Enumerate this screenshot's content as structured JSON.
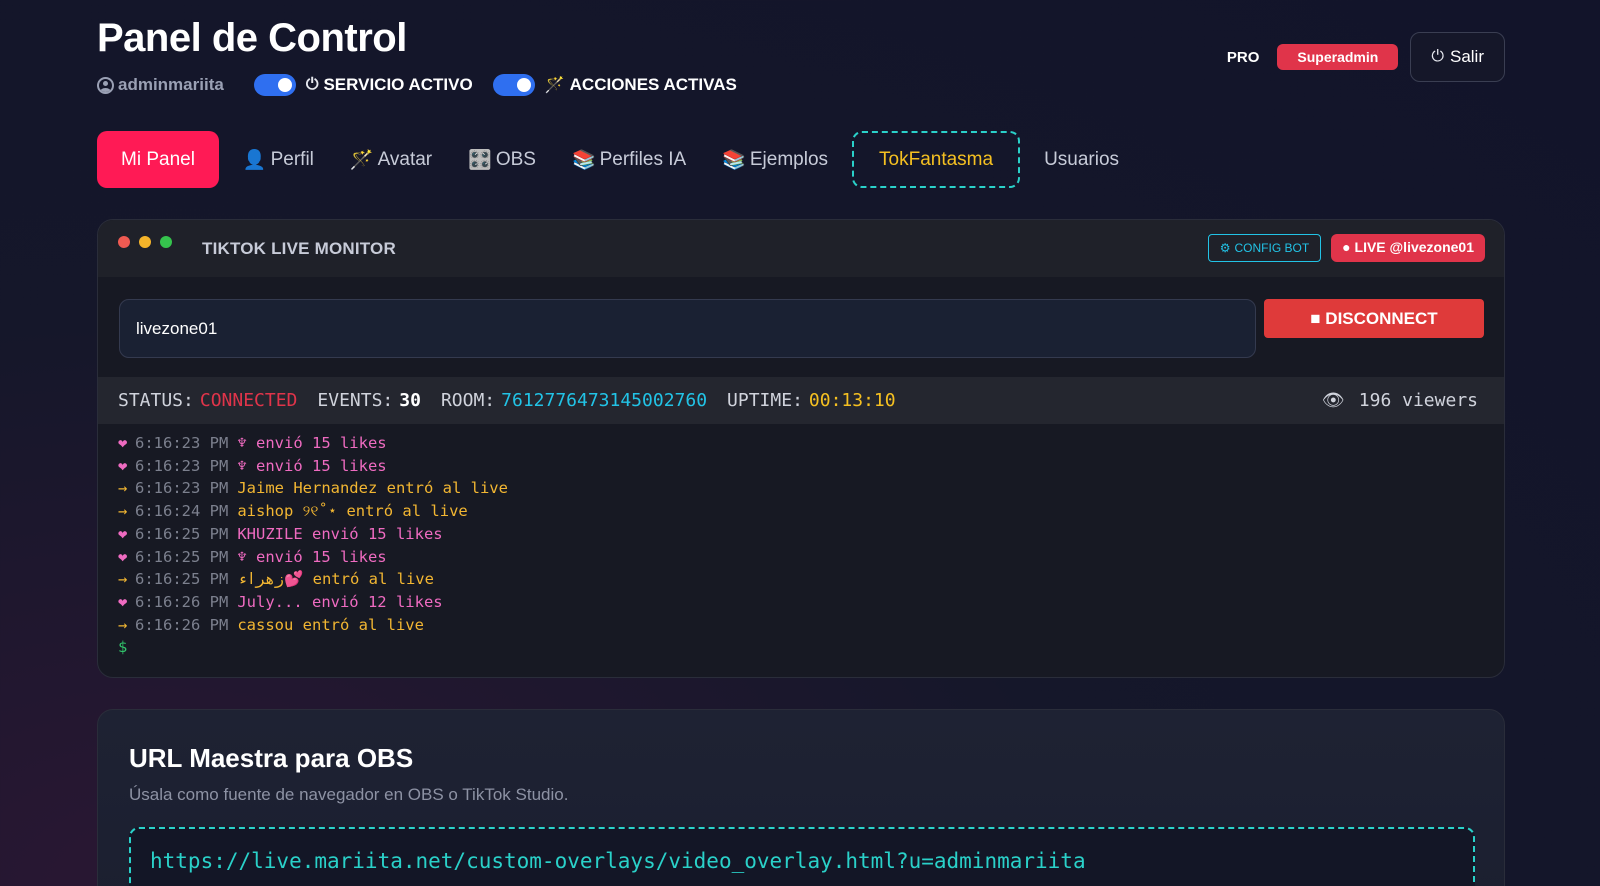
{
  "header": {
    "title": "Panel de Control",
    "username": "adminmariita",
    "service_label": "SERVICIO ACTIVO",
    "actions_label": "ACCIONES ACTIVAS",
    "service_enabled": true,
    "actions_enabled": true,
    "plan": "PRO",
    "role": "Superadmin",
    "logout_label": "Salir"
  },
  "tabs": [
    {
      "label": "Mi Panel",
      "icon": "",
      "active": true
    },
    {
      "label": "Perfil",
      "icon": "👤"
    },
    {
      "label": "Avatar",
      "icon": "🪄"
    },
    {
      "label": "OBS",
      "icon": "🎛️"
    },
    {
      "label": "Perfiles IA",
      "icon": "📚"
    },
    {
      "label": "Ejemplos",
      "icon": "📚"
    },
    {
      "label": "TokFantasma",
      "icon": "",
      "special": true
    },
    {
      "label": "Usuarios",
      "icon": ""
    }
  ],
  "monitor": {
    "title": "TIKTOK LIVE MONITOR",
    "config_label": "CONFIG BOT",
    "live_label": "● LIVE @livezone01",
    "username_value": "livezone01",
    "disconnect_label": "■ DISCONNECT",
    "status_key": "STATUS:",
    "status_value": "CONNECTED",
    "events_key": "EVENTS:",
    "events_value": "30",
    "room_key": "ROOM:",
    "room_value": "7612776473145002760",
    "uptime_key": "UPTIME:",
    "uptime_value": "00:13:10",
    "viewers": "196 viewers",
    "prompt": "$",
    "log": [
      {
        "type": "like",
        "icon": "❤",
        "time": "6:16:23 PM",
        "msg": "♆ envió 15 likes"
      },
      {
        "type": "like",
        "icon": "❤",
        "time": "6:16:23 PM",
        "msg": "♆ envió 15 likes"
      },
      {
        "type": "join",
        "icon": "→",
        "time": "6:16:23 PM",
        "msg": "Jaime Hernandez entró al live"
      },
      {
        "type": "join",
        "icon": "→",
        "time": "6:16:24 PM",
        "msg": "aishop ୨୧˚⋆ entró al live"
      },
      {
        "type": "like",
        "icon": "❤",
        "time": "6:16:25 PM",
        "msg": "KHUZILE envió 15 likes"
      },
      {
        "type": "like",
        "icon": "❤",
        "time": "6:16:25 PM",
        "msg": "♆ envió 15 likes"
      },
      {
        "type": "join",
        "icon": "→",
        "time": "6:16:25 PM",
        "msg": "زهراء💕 entró al live"
      },
      {
        "type": "like",
        "icon": "❤",
        "time": "6:16:26 PM",
        "msg": "July... envió 12 likes"
      },
      {
        "type": "join",
        "icon": "→",
        "time": "6:16:26 PM",
        "msg": "cassou entró al live"
      }
    ]
  },
  "obs": {
    "title": "URL Maestra para OBS",
    "subtitle": "Úsala como fuente de navegador en OBS o TikTok Studio.",
    "url": "https://live.mariita.net/custom-overlays/video_overlay.html?u=adminmariita"
  },
  "colors": {
    "accent": "#ff1a55",
    "danger": "#e0344a",
    "cyan": "#22c3e6",
    "teal": "#2ad1c9",
    "yellow": "#f5c021",
    "like": "#ef6bc1",
    "join": "#f2b632"
  }
}
